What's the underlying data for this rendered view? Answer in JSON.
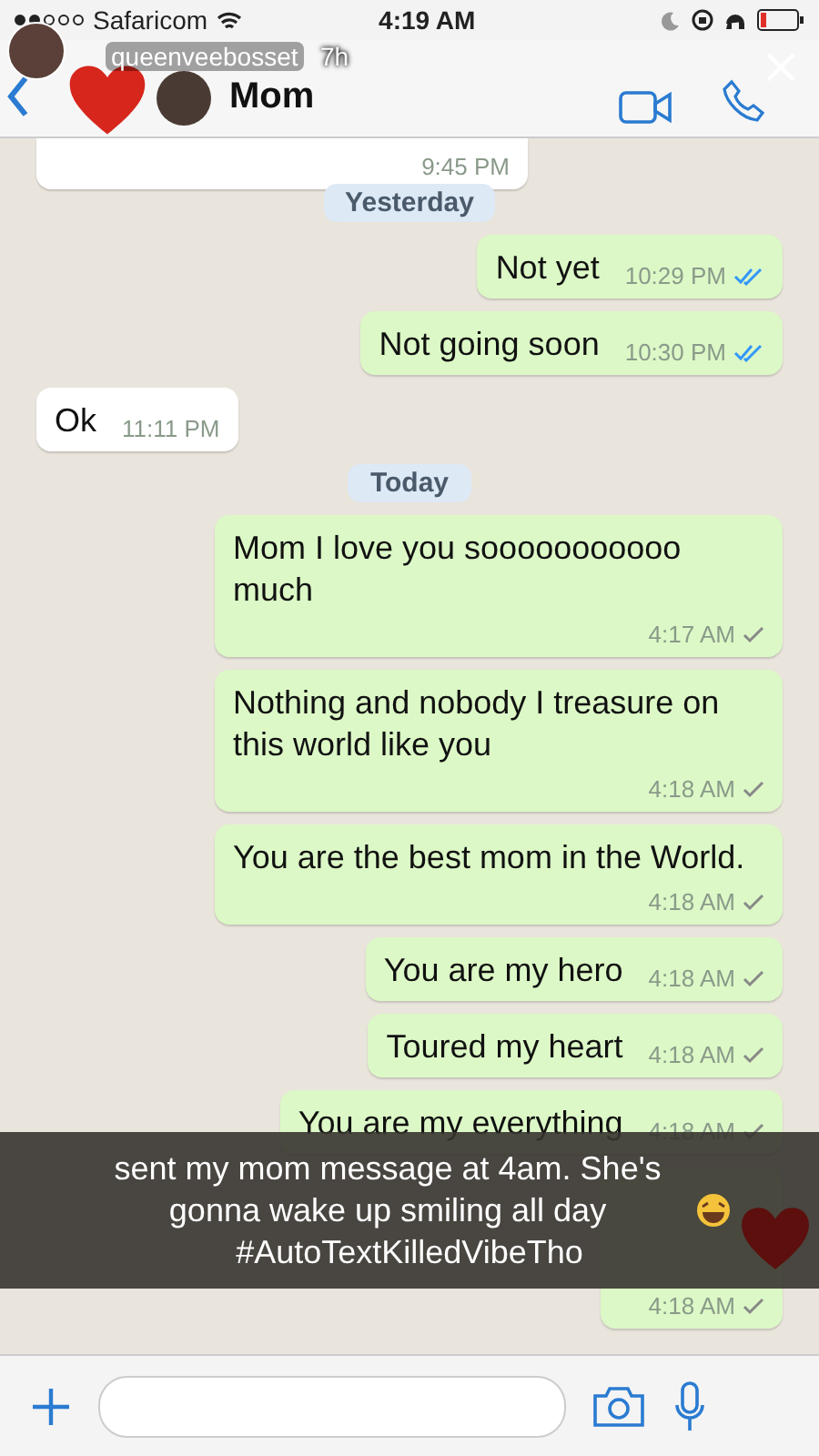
{
  "status_bar": {
    "carrier": "Safaricom",
    "time": "4:19 AM"
  },
  "story": {
    "username": "queenveebosset",
    "age": "7h",
    "caption": "sent my mom message at 4am. She's gonna wake up smiling all day",
    "hashtag": "#AutoTextKilledVibeTho"
  },
  "chat": {
    "title": "Mom"
  },
  "messages": [
    {
      "kind": "incoming",
      "time": "9:45 PM"
    },
    {
      "kind": "date",
      "text": "Yesterday"
    },
    {
      "kind": "outgoing",
      "text": "Not yet",
      "time": "10:29 PM",
      "read": true
    },
    {
      "kind": "outgoing",
      "text": "Not going soon",
      "time": "10:30 PM",
      "read": true
    },
    {
      "kind": "incoming",
      "text": "Ok",
      "time": "11:11 PM"
    },
    {
      "kind": "date",
      "text": "Today"
    },
    {
      "kind": "outgoing",
      "text": "Mom I love you sooooooooooo much",
      "time": "4:17 AM",
      "read": false
    },
    {
      "kind": "outgoing",
      "text": "Nothing and nobody I treasure on this world like you",
      "time": "4:18 AM",
      "read": false
    },
    {
      "kind": "outgoing",
      "text": "You are the best mom in the World.",
      "time": "4:18 AM",
      "read": false
    },
    {
      "kind": "outgoing",
      "text": "You are my hero",
      "time": "4:18 AM",
      "read": false
    },
    {
      "kind": "outgoing",
      "text": "Toured my heart",
      "time": "4:18 AM",
      "read": false
    },
    {
      "kind": "outgoing",
      "text": "You are my everything",
      "time": "4:18 AM",
      "read": false
    },
    {
      "kind": "outgoing",
      "time": "4:18 AM",
      "read": false
    }
  ]
}
